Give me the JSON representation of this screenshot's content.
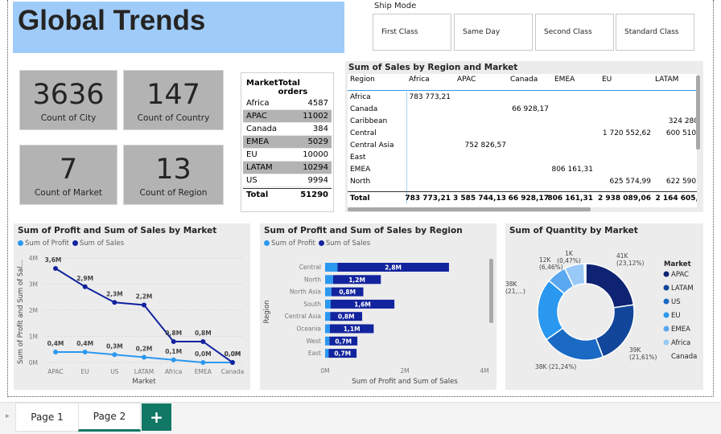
{
  "title": "Global Trends",
  "slicer": {
    "title": "Ship Mode",
    "options": [
      "First Class",
      "Same Day",
      "Second Class",
      "Standard Class"
    ]
  },
  "cards": [
    {
      "value": "3636",
      "label": "Count of City"
    },
    {
      "value": "147",
      "label": "Count of Country"
    },
    {
      "value": "7",
      "label": "Count of Market"
    },
    {
      "value": "13",
      "label": "Count of Region"
    }
  ],
  "orders_table": {
    "headers": [
      "Market",
      "Total orders"
    ],
    "rows": [
      [
        "Africa",
        "4587"
      ],
      [
        "APAC",
        "11002"
      ],
      [
        "Canada",
        "384"
      ],
      [
        "EMEA",
        "5029"
      ],
      [
        "EU",
        "10000"
      ],
      [
        "LATAM",
        "10294"
      ],
      [
        "US",
        "9994"
      ]
    ],
    "total": [
      "Total",
      "51290"
    ]
  },
  "matrix": {
    "title": "Sum of Sales by Region and Market",
    "columns": [
      "Region",
      "Africa",
      "APAC",
      "Canada",
      "EMEA",
      "EU",
      "LATAM"
    ],
    "rows": [
      {
        "region": "Africa",
        "cells": [
          "783 773,21",
          "",
          "",
          "",
          "",
          ""
        ]
      },
      {
        "region": "Canada",
        "cells": [
          "",
          "",
          "66 928,17",
          "",
          "",
          ""
        ]
      },
      {
        "region": "Caribbean",
        "cells": [
          "",
          "",
          "",
          "",
          "",
          "324 280"
        ]
      },
      {
        "region": "Central",
        "cells": [
          "",
          "",
          "",
          "",
          "1 720 552,62",
          "600 510,"
        ]
      },
      {
        "region": "Central Asia",
        "cells": [
          "",
          "752 826,57",
          "",
          "",
          "",
          ""
        ]
      },
      {
        "region": "East",
        "cells": [
          "",
          "",
          "",
          "",
          "",
          ""
        ]
      },
      {
        "region": "EMEA",
        "cells": [
          "",
          "",
          "",
          "806 161,31",
          "",
          ""
        ]
      },
      {
        "region": "North",
        "cells": [
          "",
          "",
          "",
          "",
          "625 574,99",
          "622 590,"
        ]
      }
    ],
    "total": {
      "region": "Total",
      "cells": [
        "783 773,21",
        "3 585 744,13",
        "66 928,17",
        "806 161,31",
        "2 938 089,06",
        "2 164 605,"
      ]
    }
  },
  "chart_data": [
    {
      "type": "line",
      "title": "Sum of Profit and Sum of Sales by Market",
      "xlabel": "Market",
      "ylabel": "Sum of Profit and Sum of Sal...",
      "categories": [
        "APAC",
        "EU",
        "US",
        "LATAM",
        "Africa",
        "EMEA",
        "Canada"
      ],
      "yticks": [
        "0M",
        "1M",
        "2M",
        "3M",
        "4M"
      ],
      "ylim": [
        0,
        4
      ],
      "series": [
        {
          "name": "Sum of Profit",
          "values": [
            0.4,
            0.4,
            0.3,
            0.2,
            0.1,
            0.0,
            0.0
          ],
          "labels": [
            "0,4M",
            "0,4M",
            "0,3M",
            "0,2M",
            "0,1M",
            "0,0M",
            "0,0M"
          ],
          "color": "#2b98f0"
        },
        {
          "name": "Sum of Sales",
          "values": [
            3.6,
            2.9,
            2.3,
            2.2,
            0.8,
            0.8,
            0.0
          ],
          "labels": [
            "3,6M",
            "2,9M",
            "2,3M",
            "2,2M",
            "0,8M",
            "0,8M",
            "0,0M"
          ],
          "color": "#12239e"
        }
      ]
    },
    {
      "type": "bar",
      "title": "Sum of Profit and Sum of Sales by Region",
      "xlabel": "Sum of Profit and Sum of Sales",
      "ylabel": "Region",
      "categories": [
        "Central",
        "North",
        "North Asia",
        "South",
        "Central Asia",
        "Oceania",
        "West",
        "East"
      ],
      "xticks": [
        "0M",
        "2M",
        "4M"
      ],
      "xlim": [
        0,
        4
      ],
      "series": [
        {
          "name": "Sum of Profit",
          "values": [
            0.31,
            0.2,
            0.16,
            0.14,
            0.13,
            0.12,
            0.11,
            0.09
          ],
          "color": "#2b98f0"
        },
        {
          "name": "Sum of Sales",
          "values": [
            2.8,
            1.2,
            0.8,
            1.6,
            0.8,
            1.1,
            0.7,
            0.7
          ],
          "labels": [
            "2,8M",
            "1,2M",
            "0,8M",
            "1,6M",
            "0,8M",
            "1,1M",
            "0,7M",
            "0,7M"
          ],
          "color": "#12239e"
        }
      ]
    },
    {
      "type": "pie",
      "title": "Sum of Quantity by Market",
      "legend_title": "Market",
      "categories": [
        "APAC",
        "LATAM",
        "US",
        "EU",
        "EMEA",
        "Africa",
        "Canada"
      ],
      "values": [
        41,
        39,
        38,
        38,
        12,
        12,
        1
      ],
      "percents": [
        23.12,
        21.61,
        21.24,
        21,
        6.46,
        6.4,
        0.47
      ],
      "labels": [
        "41K (23,12%)",
        "39K (21,61%)",
        "38K (21,24%)",
        "38K (21,...)",
        "12K (6,46%)",
        "",
        "1K (0,47%)"
      ],
      "colors": [
        "#0e2473",
        "#12469a",
        "#1a6ac4",
        "#2b98f0",
        "#5aa8ef",
        "#9ac9f7",
        "#c9e1fb"
      ],
      "legend_position": "right"
    }
  ],
  "tabs": [
    "Page 1",
    "Page 2"
  ],
  "add_tab_label": "+"
}
